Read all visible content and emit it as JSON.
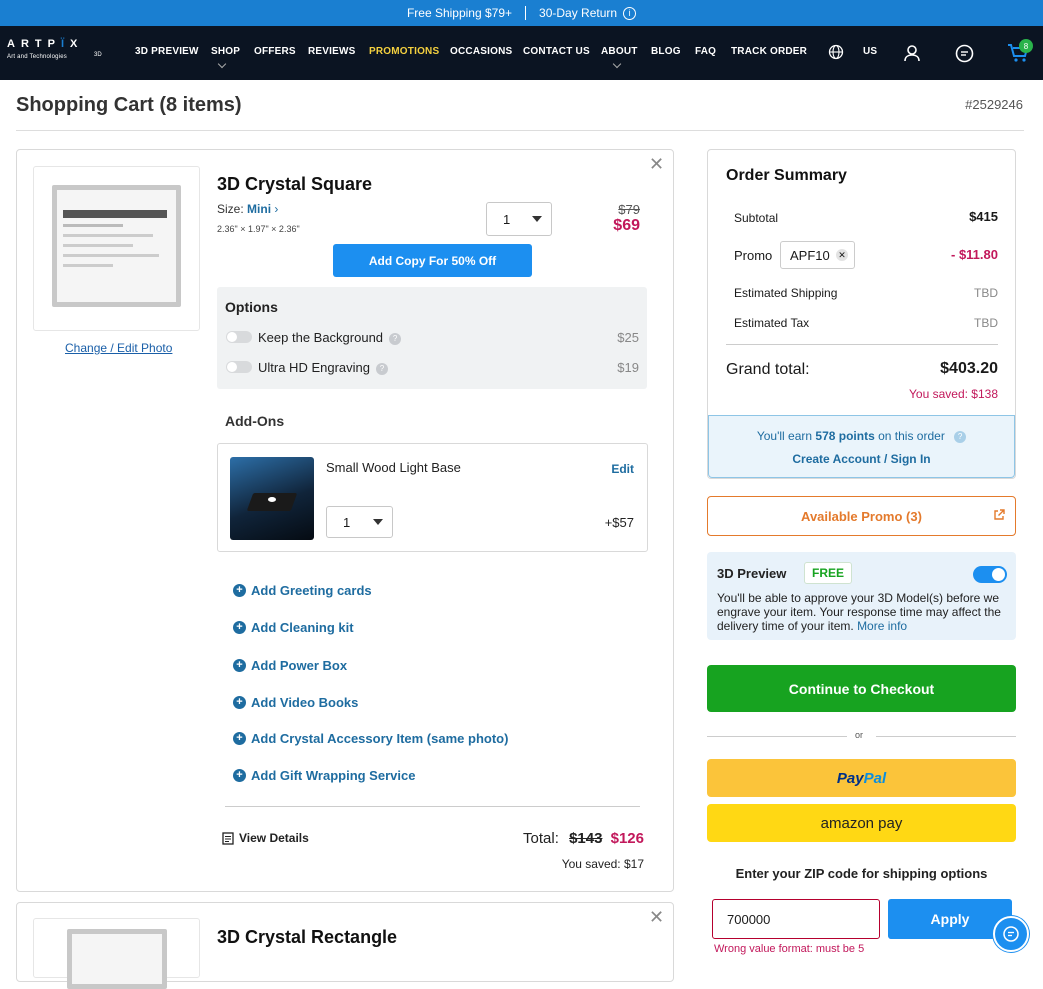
{
  "topbar": {
    "shipping": "Free Shipping $79+",
    "returns": "30-Day Return"
  },
  "logo": {
    "brand": "ARTPIX",
    "sub": "Art and Technologies",
    "suffix": "3D"
  },
  "nav": {
    "items": [
      "3D PREVIEW",
      "SHOP",
      "OFFERS",
      "REVIEWS",
      "PROMOTIONS",
      "OCCASIONS",
      "CONTACT US",
      "ABOUT",
      "BLOG",
      "FAQ",
      "TRACK ORDER"
    ],
    "region": "US",
    "cart_count": "8"
  },
  "page": {
    "title": "Shopping Cart (8 items)",
    "order_number": "#2529246"
  },
  "item1": {
    "name": "3D Crystal Square",
    "size_label": "Size:",
    "size_value": "Mini",
    "dimensions": "2.36\" × 1.97\" × 2.36\"",
    "change_photo": "Change / Edit Photo",
    "qty": "1",
    "old_price": "$79",
    "price": "$69",
    "add_copy": "Add Copy For 50% Off",
    "options_title": "Options",
    "options": [
      {
        "label": "Keep the Background",
        "price": "$25"
      },
      {
        "label": "Ultra HD Engraving",
        "price": "$19"
      }
    ],
    "addons_title": "Add-Ons",
    "addon": {
      "name": "Small Wood Light Base",
      "edit": "Edit",
      "qty": "1",
      "price": "+$57"
    },
    "add_links": [
      "Add Greeting cards",
      "Add Cleaning kit",
      "Add Power Box",
      "Add Video Books",
      "Add Crystal Accessory Item (same photo)",
      "Add Gift Wrapping Service"
    ],
    "view_details": "View Details",
    "total_label": "Total:",
    "total_old": "$143",
    "total_new": "$126",
    "saved": "You saved: $17"
  },
  "item2": {
    "name": "3D Crystal Rectangle"
  },
  "summary": {
    "title": "Order Summary",
    "subtotal_label": "Subtotal",
    "subtotal": "$415",
    "promo_label": "Promo",
    "promo_code": "APF10",
    "promo_value": "- $11.80",
    "shipping_label": "Estimated Shipping",
    "shipping": "TBD",
    "tax_label": "Estimated Tax",
    "tax": "TBD",
    "grand_label": "Grand total:",
    "grand": "$403.20",
    "saved": "You saved: $138"
  },
  "points": {
    "pre": "You'll earn",
    "num": "578 points",
    "post": "on this order",
    "account": "Create Account / Sign In"
  },
  "available_promo": "Available Promo (3)",
  "preview": {
    "title": "3D Preview",
    "badge": "FREE",
    "text": "You'll be able to approve your 3D Model(s) before we engrave your item. Your response time may affect the delivery time of your item.",
    "more": "More info"
  },
  "checkout": "Continue to Checkout",
  "or": "or",
  "paypal": "PayPal",
  "amazon": "amazon pay",
  "zip": {
    "label": "Enter your ZIP code for shipping options",
    "value": "700000",
    "apply": "Apply",
    "error": "Wrong value format: must be 5"
  },
  "colors": {
    "topbar": "#1a7fd1",
    "nav": "#0b1422",
    "accent": "#1c8ff0",
    "price_red": "#c2185b",
    "checkout": "#17a320",
    "promo_orange": "#e47a2c"
  }
}
